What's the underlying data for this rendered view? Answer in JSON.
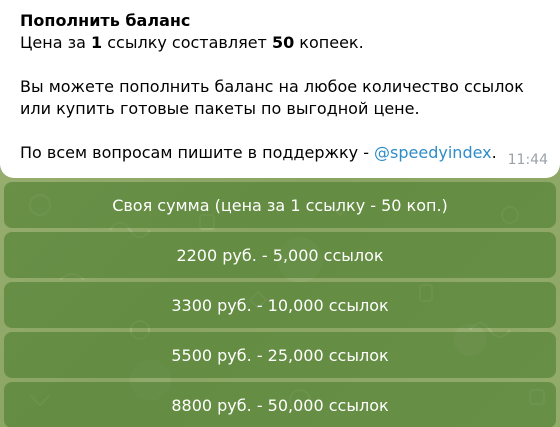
{
  "message": {
    "title": "Пополнить баланс",
    "price_prefix": "Цена за ",
    "price_count": "1",
    "price_middle": " ссылку составляет ",
    "price_value": "50",
    "price_suffix": " копеек.",
    "body_line1": "Вы можете пополнить баланс на любое количество ссылок",
    "body_line2": "или купить готовые пакеты по выгодной цене.",
    "support_text": "По всем вопросам пишите в поддержку - ",
    "support_mention": "@speedyindex",
    "support_end": ".",
    "time": "11:44"
  },
  "keyboard": {
    "buttons": [
      {
        "label": "Своя сумма (цена за 1 ссылку - 50 коп.)"
      },
      {
        "label": "2200 руб. - 5,000 ссылок"
      },
      {
        "label": "3300 руб. - 10,000 ссылок"
      },
      {
        "label": "5500 руб. - 25,000 ссылок"
      },
      {
        "label": "8800 руб. - 50,000 ссылок"
      }
    ]
  },
  "colors": {
    "background": "#8fa86a",
    "bubble": "#ffffff",
    "mention": "#2e8dc8",
    "button": "#4e7a30",
    "timestamp": "#9aa3a8"
  }
}
